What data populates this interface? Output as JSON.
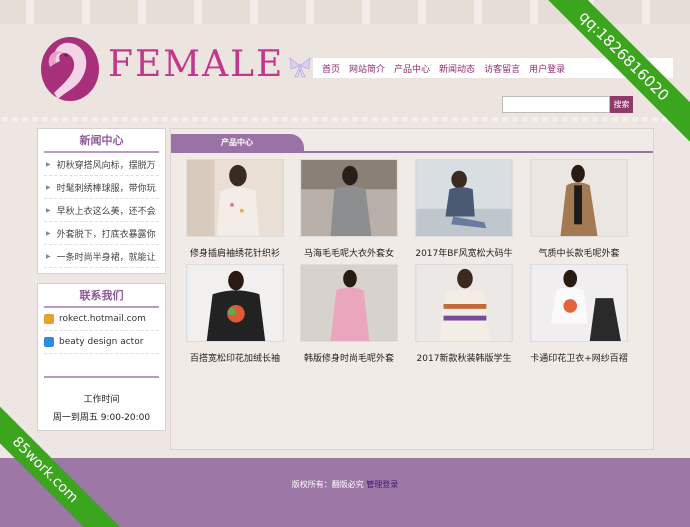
{
  "logo": {
    "text": "FEMALE"
  },
  "nav": [
    "首页",
    "网站简介",
    "产品中心",
    "新闻动态",
    "访客留言",
    "用户登录"
  ],
  "search": {
    "button_label": "搜索",
    "placeholder": ""
  },
  "news": {
    "title": "新闻中心",
    "items": [
      "初秋穿搭风向标，摆脱万",
      "时髦刺绣棒球服，带你玩",
      "早秋上衣这么美，还不会",
      "外套脱下，打底衣暴露你",
      "一条时尚半身裙，就能让"
    ]
  },
  "contact": {
    "title": "联系我们",
    "email": "rokect.hotmail.com",
    "skype": "beaty design actor",
    "hours_label": "工作时间",
    "hours_value": "周一到周五 9:00-20:00"
  },
  "products": {
    "tab_label": "产品中心",
    "items": [
      "修身插肩袖绣花针织衫",
      "马海毛毛呢大衣外套女",
      "2017年BF风宽松大码牛",
      "气质中长款毛呢外套",
      "百搭宽松印花加绒长袖",
      "韩版修身时尚毛呢外套",
      "2017新款秋装韩版学生",
      "卡通印花卫衣+网纱百褶"
    ]
  },
  "footer": {
    "copyright": "版权所有：翻版必究",
    "admin_link": "管理登录"
  },
  "ribbons": {
    "top_right": "qq:1826816020",
    "bottom_left": "85work.com"
  },
  "colors": {
    "brand": "#c0378c",
    "accent": "#9a72a5",
    "footer": "#9d78a7",
    "ribbon": "#3aa51d"
  }
}
